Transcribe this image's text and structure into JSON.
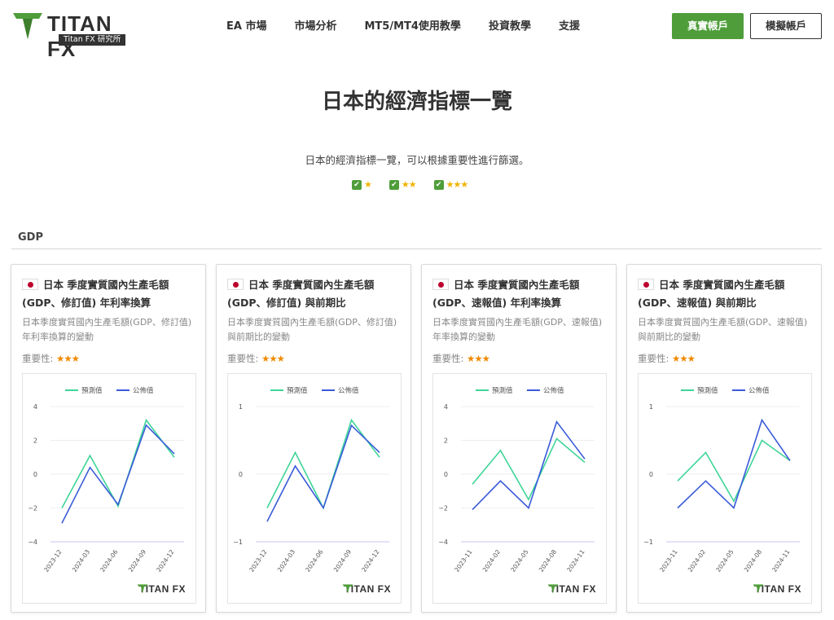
{
  "brand": {
    "name_main": "TITAN",
    "name_fx": "FX",
    "sub": "Titan FX 研究所",
    "green": "#4f9d3a"
  },
  "nav": {
    "items": [
      "EA 市場",
      "市場分析",
      "MT5/MT4使用教學",
      "投資教學",
      "支援"
    ]
  },
  "actions": {
    "real": "真實帳戶",
    "demo": "模擬帳戶"
  },
  "page": {
    "title": "日本的經濟指標一覽",
    "description": "日本的經濟指標一覽，可以根據重要性進行篩選。",
    "filters": [
      "★",
      "★★",
      "★★★"
    ]
  },
  "section": {
    "title": "GDP"
  },
  "importance_label": "重要性:",
  "legend": {
    "forecast": "預測值",
    "actual": "公佈值"
  },
  "colors": {
    "forecast": "#3ed598",
    "actual": "#3a5bd9",
    "grid": "#eeeeee",
    "baseline": "#c9c3f0"
  },
  "watermark": "TITAN FX",
  "cards": [
    {
      "title": "日本 季度實質國內生產毛額(GDP、修訂值) 年利率換算",
      "desc": "日本季度實質國內生產毛額(GDP、修訂值)年利率換算的變動",
      "stars": "★★★",
      "chart_data": {
        "type": "line",
        "categories": [
          "2023-12",
          "2024-03",
          "2024-06",
          "2024-09",
          "2024-12"
        ],
        "ylim": [
          -4,
          4
        ],
        "yticks": [
          4,
          2,
          0,
          -2,
          -4
        ],
        "series": [
          {
            "name": "預測值",
            "values": [
              -2.0,
              1.1,
              -1.9,
              3.2,
              1.0
            ]
          },
          {
            "name": "公佈值",
            "values": [
              -2.9,
              0.4,
              -1.8,
              2.9,
              1.2
            ]
          }
        ]
      }
    },
    {
      "title": "日本 季度實質國內生產毛額(GDP、修訂值) 與前期比",
      "desc": "日本季度實質國內生產毛額(GDP、修訂值)與前期比的變動",
      "stars": "★★★",
      "chart_data": {
        "type": "line",
        "categories": [
          "2023-12",
          "2024-03",
          "2024-06",
          "2024-09",
          "2024-12"
        ],
        "ylim": [
          -1,
          1
        ],
        "yticks": [
          1,
          0,
          -1
        ],
        "series": [
          {
            "name": "預測值",
            "values": [
              -0.5,
              0.32,
              -0.5,
              0.8,
              0.25
            ]
          },
          {
            "name": "公佈值",
            "values": [
              -0.7,
              0.12,
              -0.5,
              0.72,
              0.32
            ]
          }
        ]
      }
    },
    {
      "title": "日本 季度實質國內生產毛額(GDP、速報值) 年利率換算",
      "desc": "日本季度實質國內生產毛額(GDP、速報值)年率換算的變動",
      "stars": "★★★",
      "chart_data": {
        "type": "line",
        "categories": [
          "2023-11",
          "2024-02",
          "2024-05",
          "2024-08",
          "2024-11"
        ],
        "ylim": [
          -4,
          4
        ],
        "yticks": [
          4,
          2,
          0,
          -2,
          -4
        ],
        "series": [
          {
            "name": "預測值",
            "values": [
              -0.6,
              1.4,
              -1.5,
              2.1,
              0.7
            ]
          },
          {
            "name": "公佈值",
            "values": [
              -2.1,
              -0.4,
              -2.0,
              3.1,
              0.9
            ]
          }
        ]
      }
    },
    {
      "title": "日本 季度實質國內生產毛額(GDP、速報值) 與前期比",
      "desc": "日本季度實質國內生產毛額(GDP、速報值)與前期比的變動",
      "stars": "★★★",
      "chart_data": {
        "type": "line",
        "categories": [
          "2023-11",
          "2024-02",
          "2024-05",
          "2024-08",
          "2024-11"
        ],
        "ylim": [
          -1,
          1
        ],
        "yticks": [
          1,
          0,
          -1
        ],
        "series": [
          {
            "name": "預測值",
            "values": [
              -0.1,
              0.32,
              -0.4,
              0.5,
              0.2
            ]
          },
          {
            "name": "公佈值",
            "values": [
              -0.5,
              -0.1,
              -0.5,
              0.8,
              0.2
            ]
          }
        ]
      }
    }
  ]
}
